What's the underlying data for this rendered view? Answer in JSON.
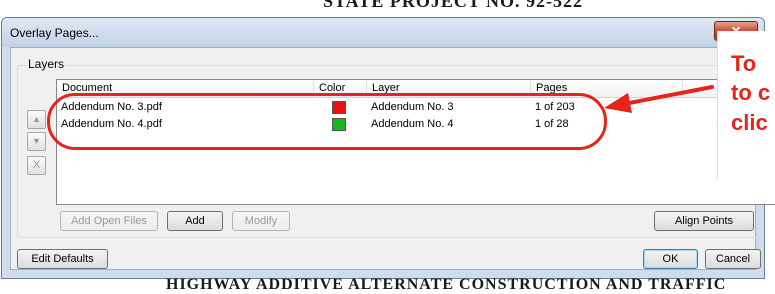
{
  "background": {
    "top_text": "STATE PROJECT NO. 92-522",
    "bottom_text": "HIGHWAY ADDITIVE ALTERNATE CONSTRUCTION AND TRAFFIC"
  },
  "dialog": {
    "title": "Overlay Pages...",
    "close_glyph": "✕",
    "group_label": "Layers",
    "side_buttons": {
      "up": "▲",
      "down": "▼",
      "remove": "X"
    },
    "columns": [
      "Document",
      "Color",
      "Layer",
      "Pages"
    ],
    "rows": [
      {
        "document": "Addendum No. 3.pdf",
        "color": "#e81010",
        "layer": "Addendum No. 3",
        "pages": "1 of 203"
      },
      {
        "document": "Addendum No. 4.pdf",
        "color": "#18b41e",
        "layer": "Addendum No. 4",
        "pages": "1 of 28"
      }
    ],
    "buttons": {
      "add_open_files": "Add Open Files",
      "add": "Add",
      "modify": "Modify",
      "align_points": "Align Points",
      "edit_defaults": "Edit Defaults",
      "ok": "OK",
      "cancel": "Cancel"
    }
  },
  "annotation": {
    "line1": "To",
    "line2": "to c",
    "line3": "clic",
    "color": "#e8231a"
  }
}
